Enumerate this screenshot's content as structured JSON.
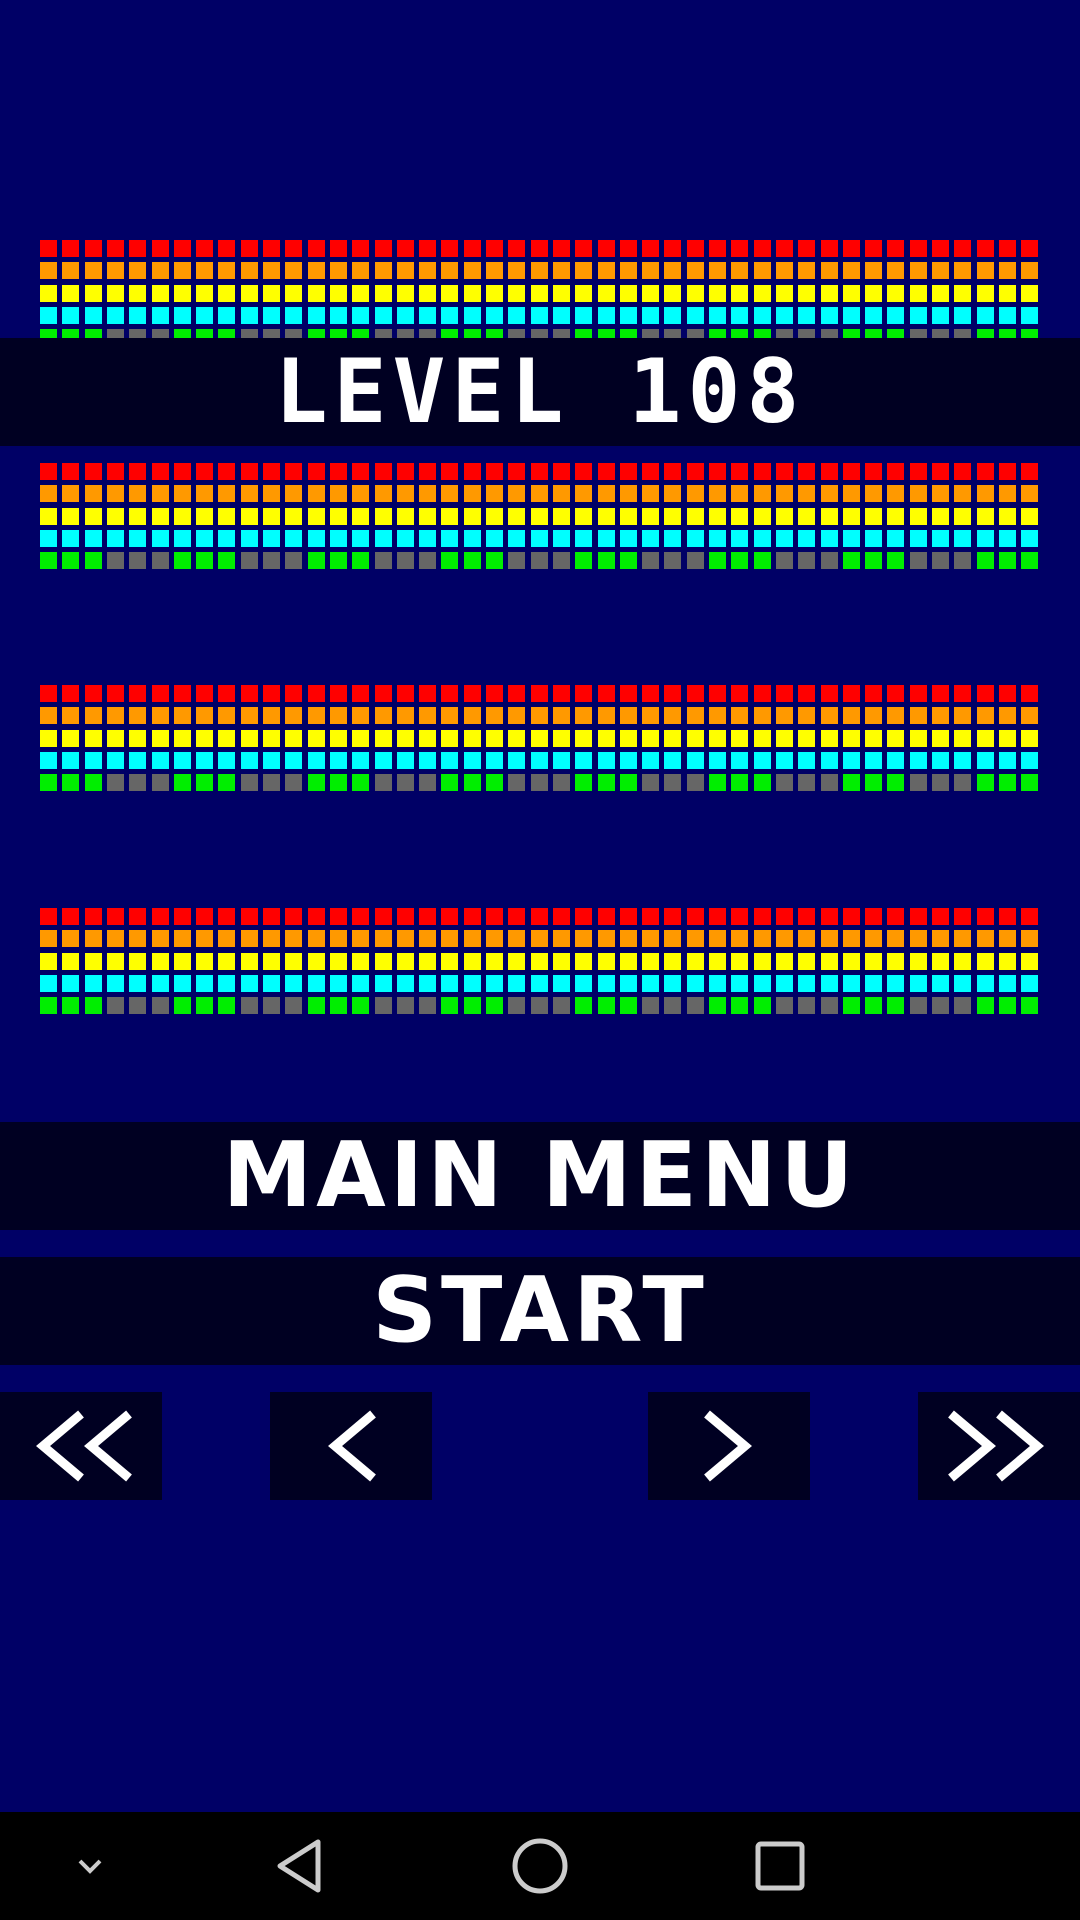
{
  "level_label": "LEVEL 108",
  "menu": {
    "main_menu_label": "MAIN MENU",
    "start_label": "START"
  },
  "navigation": {
    "first_icon": "double-chevron-left-icon",
    "prev_icon": "chevron-left-icon",
    "next_icon": "chevron-right-icon",
    "last_icon": "double-chevron-right-icon"
  },
  "system_bar": {
    "icons": [
      "chevron-down-icon",
      "back-triangle-icon",
      "home-circle-icon",
      "recents-square-icon"
    ]
  },
  "colors": {
    "background": "#000066",
    "bar_background": "#000022",
    "row_red": "#ff0000",
    "row_orange": "#ff9900",
    "row_yellow": "#ffff00",
    "row_cyan": "#00ffff",
    "row_green_lit": "#00ee00",
    "row_unlit": "#666666",
    "text": "#ffffff"
  },
  "level_grids": {
    "columns": 45,
    "row_colors": [
      "row_red",
      "row_orange",
      "row_yellow",
      "row_cyan",
      "bottom"
    ],
    "bottom_pattern": "alternating groups of 3: green, gray",
    "count": 4
  }
}
